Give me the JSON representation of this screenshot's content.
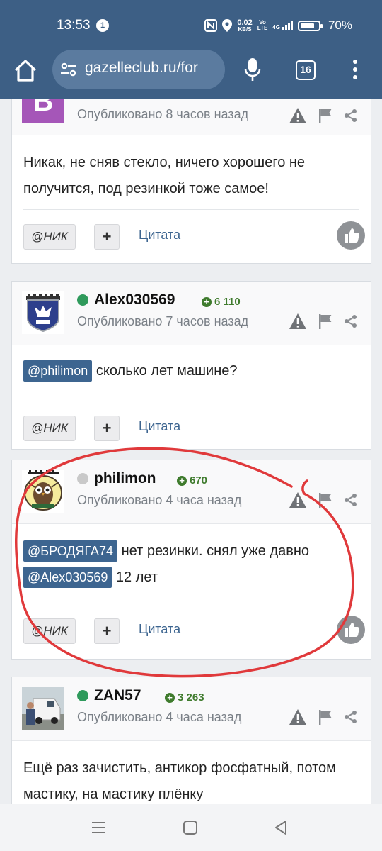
{
  "status": {
    "time": "13:53",
    "notif_count": "1",
    "net_speed": "0.02",
    "net_unit": "KB/S",
    "volte1": "Vo",
    "volte2": "LTE",
    "net_gen": "4G",
    "battery": "70%"
  },
  "browser": {
    "url": "gazelleclub.ru/for",
    "tabs_count": "16"
  },
  "posts": [
    {
      "published": "Опубликовано 8 часов назад",
      "body": "Никак, не сняв стекло, ничего хорошего не получится, под резинкой тоже самое!",
      "nick_label": "@НИК",
      "plus_label": "+",
      "quote_label": "Цитата"
    },
    {
      "author": "Alex030569",
      "rep": "6 110",
      "published": "Опубликовано 7 часов назад",
      "mention": "@philimon",
      "body": "сколько лет машине?",
      "nick_label": "@НИК",
      "plus_label": "+",
      "quote_label": "Цитата"
    },
    {
      "author": "philimon",
      "rep": "670",
      "published": "Опубликовано 4 часа назад",
      "mention1": "@БРОДЯГА74",
      "text1": "нет резинки. снял уже давно",
      "mention2": "@Alex030569",
      "text2": "12 лет",
      "nick_label": "@НИК",
      "plus_label": "+",
      "quote_label": "Цитата"
    },
    {
      "author": "ZAN57",
      "rep": "3 263",
      "published": "Опубликовано 4 часа назад",
      "body": "Ещё раз зачистить, антикор фосфатный, потом мастику, на мастику плёнку"
    }
  ],
  "colors": {
    "header": "#3d5f85",
    "mention": "#3d6590",
    "online": "#2f9a5c",
    "reputation": "#3f7b2d",
    "annotation_circle": "#e0393b"
  }
}
